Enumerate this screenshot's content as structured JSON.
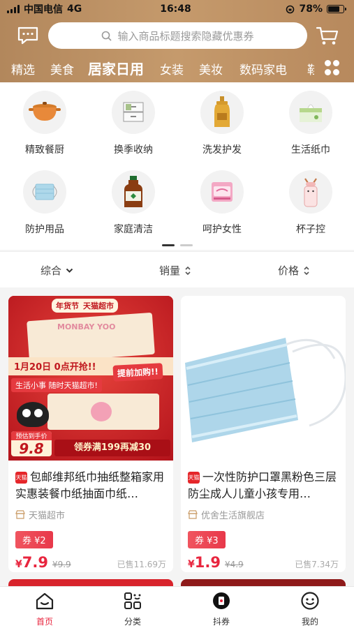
{
  "status": {
    "carrier": "中国电信",
    "network": "4G",
    "time": "16:48",
    "battery": "78%",
    "battery_level": 0.78
  },
  "search": {
    "placeholder": "输入商品标题搜索隐藏优惠券"
  },
  "tabs": [
    "精选",
    "美食",
    "居家日用",
    "女装",
    "美妆",
    "数码家电",
    "鞋"
  ],
  "categories": [
    {
      "label": "精致餐厨",
      "icon": "pot-icon"
    },
    {
      "label": "换季收纳",
      "icon": "storage-box-icon"
    },
    {
      "label": "洗发护发",
      "icon": "shampoo-icon"
    },
    {
      "label": "生活纸巾",
      "icon": "tissue-icon"
    },
    {
      "label": "防护用品",
      "icon": "mask-icon"
    },
    {
      "label": "家庭清洁",
      "icon": "disinfectant-icon"
    },
    {
      "label": "呵护女性",
      "icon": "sanitary-pad-icon"
    },
    {
      "label": "杯子控",
      "icon": "cup-icon"
    }
  ],
  "sort": {
    "general": "综合",
    "sales": "销量",
    "price": "价格"
  },
  "products": [
    {
      "title": "包邮维邦纸巾抽纸整箱家用实惠装餐巾纸抽面巾纸…",
      "tmall_tag": "天猫",
      "shop": "天猫超市",
      "coupon": "券 ¥2",
      "price_symbol": "¥",
      "price": "7.9",
      "original_price": "¥9.9",
      "sold": "已售11.69万",
      "banner": {
        "festival": "年货节",
        "store": "天猫超市",
        "date_line": "1月20日 0点开抢!!",
        "pre_add": "提前加购!!",
        "slogan": "生活小事 随时天猫超市!",
        "presale_label": "预估到手价",
        "presale_price": "9.8",
        "promo": "领券满199再减30",
        "brand_text": "MONBAY YOO"
      }
    },
    {
      "title": "一次性防护口罩黑粉色三层防尘成人儿童小孩专用…",
      "tmall_tag": "天猫",
      "shop": "优舍生活旗舰店",
      "coupon": "券 ¥3",
      "price_symbol": "¥",
      "price": "1.9",
      "original_price": "¥4.9",
      "sold": "已售7.34万"
    }
  ],
  "bottom_nav": [
    {
      "label": "首页",
      "icon": "home-icon"
    },
    {
      "label": "分类",
      "icon": "category-icon"
    },
    {
      "label": "抖券",
      "icon": "douquan-icon"
    },
    {
      "label": "我的",
      "icon": "profile-icon"
    }
  ],
  "colors": {
    "header": "#c2976a",
    "accent": "#e8253e",
    "background": "#f4f4f4"
  }
}
